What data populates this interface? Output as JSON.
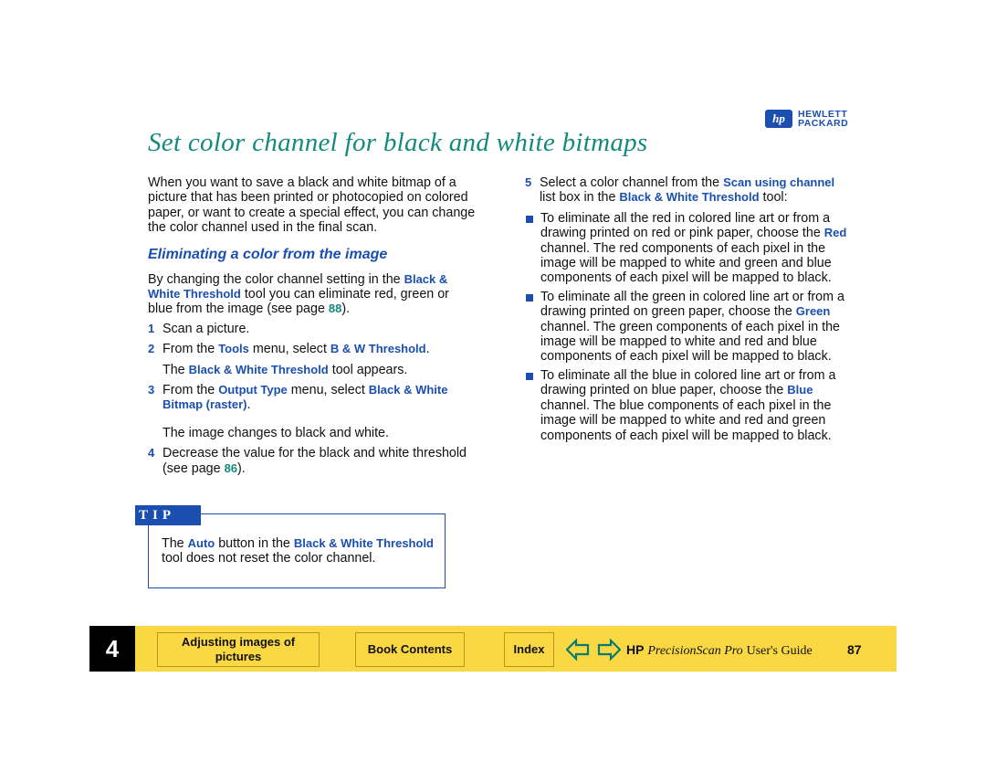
{
  "logo": {
    "line1": "HEWLETT",
    "line2": "PACKARD",
    "mark": "hp"
  },
  "title": "Set color channel for black and white bitmaps",
  "intro": [
    {
      "t": "When you want to save a black and white bitmap of a picture that has been printed or photocopied on colored paper, or want to create a special effect, you can change the color channel used in the final scan."
    }
  ],
  "subheading": "Eliminating a color from the image",
  "para": [
    {
      "t": "By changing the color channel setting in the "
    },
    {
      "t": "Black & White Threshold",
      "s": "b"
    },
    {
      "t": " tool you can eliminate red, green or blue from the image (see page "
    },
    {
      "t": "88",
      "s": "g"
    },
    {
      "t": ")."
    }
  ],
  "steps": [
    {
      "n": "1",
      "text": [
        {
          "t": "Scan a picture."
        }
      ]
    },
    {
      "n": "2",
      "text": [
        {
          "t": "From the "
        },
        {
          "t": "Tools",
          "s": "b"
        },
        {
          "t": " menu, select "
        },
        {
          "t": "B & W Threshold",
          "s": "b"
        },
        {
          "t": "."
        }
      ],
      "after": [
        {
          "t": "The "
        },
        {
          "t": "Black & White Threshold",
          "s": "b"
        },
        {
          "t": " tool appears."
        }
      ]
    },
    {
      "n": "3",
      "text": [
        {
          "t": "From the "
        },
        {
          "t": "Output Type",
          "s": "b"
        },
        {
          "t": " menu, select "
        },
        {
          "t": "Black & White Bitmap (raster)",
          "s": "b"
        },
        {
          "t": "."
        }
      ],
      "after": [
        {
          "t": "The image changes to black and white."
        }
      ]
    },
    {
      "n": "4",
      "text": [
        {
          "t": "Decrease the value for the black and white threshold (see page "
        },
        {
          "t": "86",
          "s": "g"
        },
        {
          "t": ")."
        }
      ]
    },
    {
      "n": "5",
      "text": [
        {
          "t": "Select a color channel from the "
        },
        {
          "t": "Scan using channel",
          "s": "b"
        },
        {
          "t": " list box in the "
        },
        {
          "t": "Black & White Threshold",
          "s": "b"
        },
        {
          "t": " tool:"
        }
      ]
    }
  ],
  "bullets": [
    [
      {
        "t": "To eliminate all the red in colored line art or from a drawing printed on red or pink paper, choose the "
      },
      {
        "t": "Red",
        "s": "b"
      },
      {
        "t": " channel. The red components of each pixel in the image will be mapped to white and green and blue components of each pixel will be mapped to black."
      }
    ],
    [
      {
        "t": "To eliminate all the green in colored line art or from a drawing printed on green paper, choose the "
      },
      {
        "t": "Green",
        "s": "b"
      },
      {
        "t": " channel. The green components of each pixel in the image will be mapped to white and red and blue components of each pixel will be mapped to black."
      }
    ],
    [
      {
        "t": "To eliminate all the blue in colored line art or from a drawing printed on blue paper, choose the "
      },
      {
        "t": "Blue",
        "s": "b"
      },
      {
        "t": " channel. The blue components of each pixel in the image will be mapped to white and red and green components of each pixel will be mapped to black."
      }
    ]
  ],
  "tip": {
    "label": "TIP",
    "text": [
      {
        "t": "The "
      },
      {
        "t": "Auto",
        "s": "b"
      },
      {
        "t": " button in the "
      },
      {
        "t": "Black & White Threshold",
        "s": "b"
      },
      {
        "t": " tool does not reset the color channel."
      }
    ]
  },
  "footer": {
    "chapter": "4",
    "section_button": "Adjusting images of pictures",
    "contents_button": "Book Contents",
    "index_button": "Index",
    "hp": "HP",
    "product": "PrecisionScan Pro",
    "guide": "User's Guide",
    "page": "87",
    "prev_icon": "arrow-left-icon",
    "next_icon": "arrow-right-icon"
  },
  "colors": {
    "accent_blue": "#1a4fb0",
    "title_teal": "#138a7c",
    "footer_yellow": "#f9d843"
  }
}
